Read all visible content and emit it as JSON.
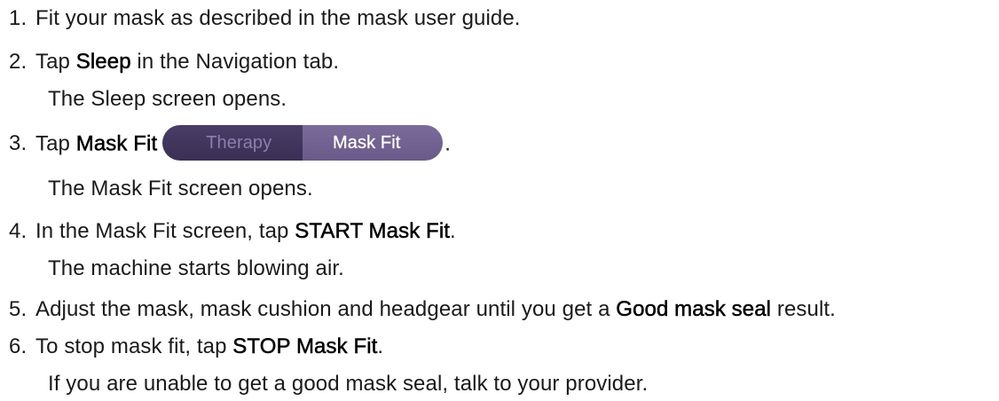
{
  "steps": [
    {
      "number": "1.",
      "text_before": "Fit your mask as described in the mask user guide."
    },
    {
      "number": "2.",
      "text_before": "Tap ",
      "bold": "Sleep",
      "text_after": " in the Navigation tab.",
      "result": "The Sleep screen opens."
    },
    {
      "number": "3.",
      "text_before": "Tap ",
      "bold": "Mask Fit",
      "text_after": ".",
      "toggle": {
        "left_label": "Therapy",
        "right_label": "Mask Fit",
        "selected": "Mask Fit"
      },
      "result": "The Mask Fit screen opens."
    },
    {
      "number": "4.",
      "text_before": "In the Mask Fit screen, tap ",
      "bold": "START Mask Fit",
      "text_after": ".",
      "result": "The machine starts blowing air."
    },
    {
      "number": "5.",
      "text_before": "Adjust the mask, mask cushion and headgear until you get a ",
      "bold": "Good mask seal",
      "text_after": " result."
    },
    {
      "number": "6.",
      "text_before": "To stop mask fit, tap ",
      "bold": "STOP Mask Fit",
      "text_after": ".",
      "result": "If you are unable to get a good mask seal, talk to your provider."
    }
  ],
  "colors": {
    "text": "#1a1a1a",
    "toggle_dark": "#3b2f55",
    "toggle_selected": "#6a5a8a",
    "toggle_dark_text": "#8c7fae",
    "toggle_selected_text": "#ffffff"
  }
}
